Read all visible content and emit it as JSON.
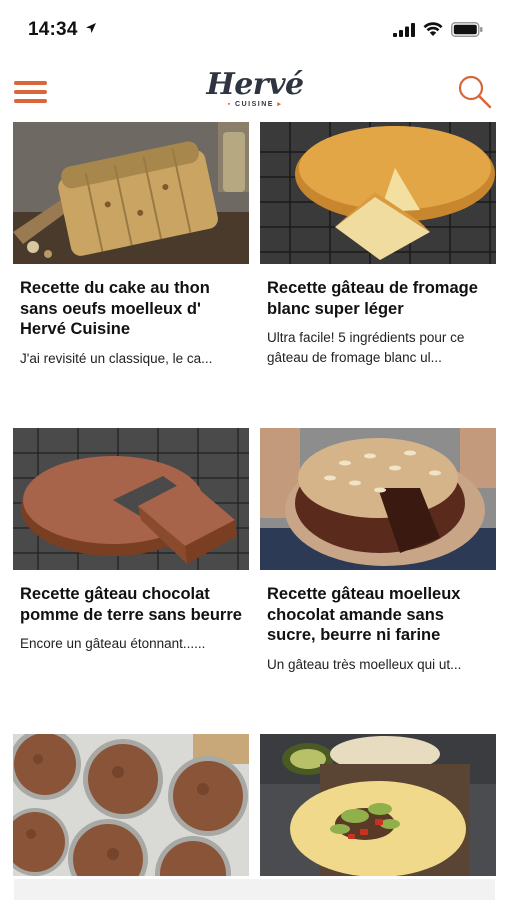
{
  "status_bar": {
    "time": "14:34",
    "icons": [
      "location-arrow-icon",
      "cellular-signal-icon",
      "wifi-icon",
      "battery-icon"
    ]
  },
  "header": {
    "logo_text": "Hervé",
    "logo_subtext": "CUISINE",
    "menu_icon": "hamburger-menu-icon",
    "search_icon": "search-icon",
    "accent_color": "#d9663a"
  },
  "recipes": [
    {
      "title": "Recette du cake au thon sans oeufs moelleux d' Hervé Cuisine",
      "description": "J'ai revisité un classique, le ca...",
      "image": "tuna-cake-image"
    },
    {
      "title": "Recette gâteau de fromage blanc super léger",
      "description": "Ultra facile! 5 ingrédients pour ce gâteau de fromage blanc ul...",
      "image": "cheesecake-image"
    },
    {
      "title": "Recette gâteau chocolat pomme de terre sans beurre",
      "description": "Encore un gâteau étonnant......",
      "image": "chocolate-cake-image"
    },
    {
      "title": "Recette gâteau moelleux chocolat amande sans sucre, beurre ni farine",
      "description": "Un gâteau très moelleux qui ut...",
      "image": "almond-chocolate-cake-image"
    },
    {
      "title": "",
      "description": "",
      "image": "muffins-image"
    },
    {
      "title": "",
      "description": "",
      "image": "tortilla-image"
    }
  ]
}
